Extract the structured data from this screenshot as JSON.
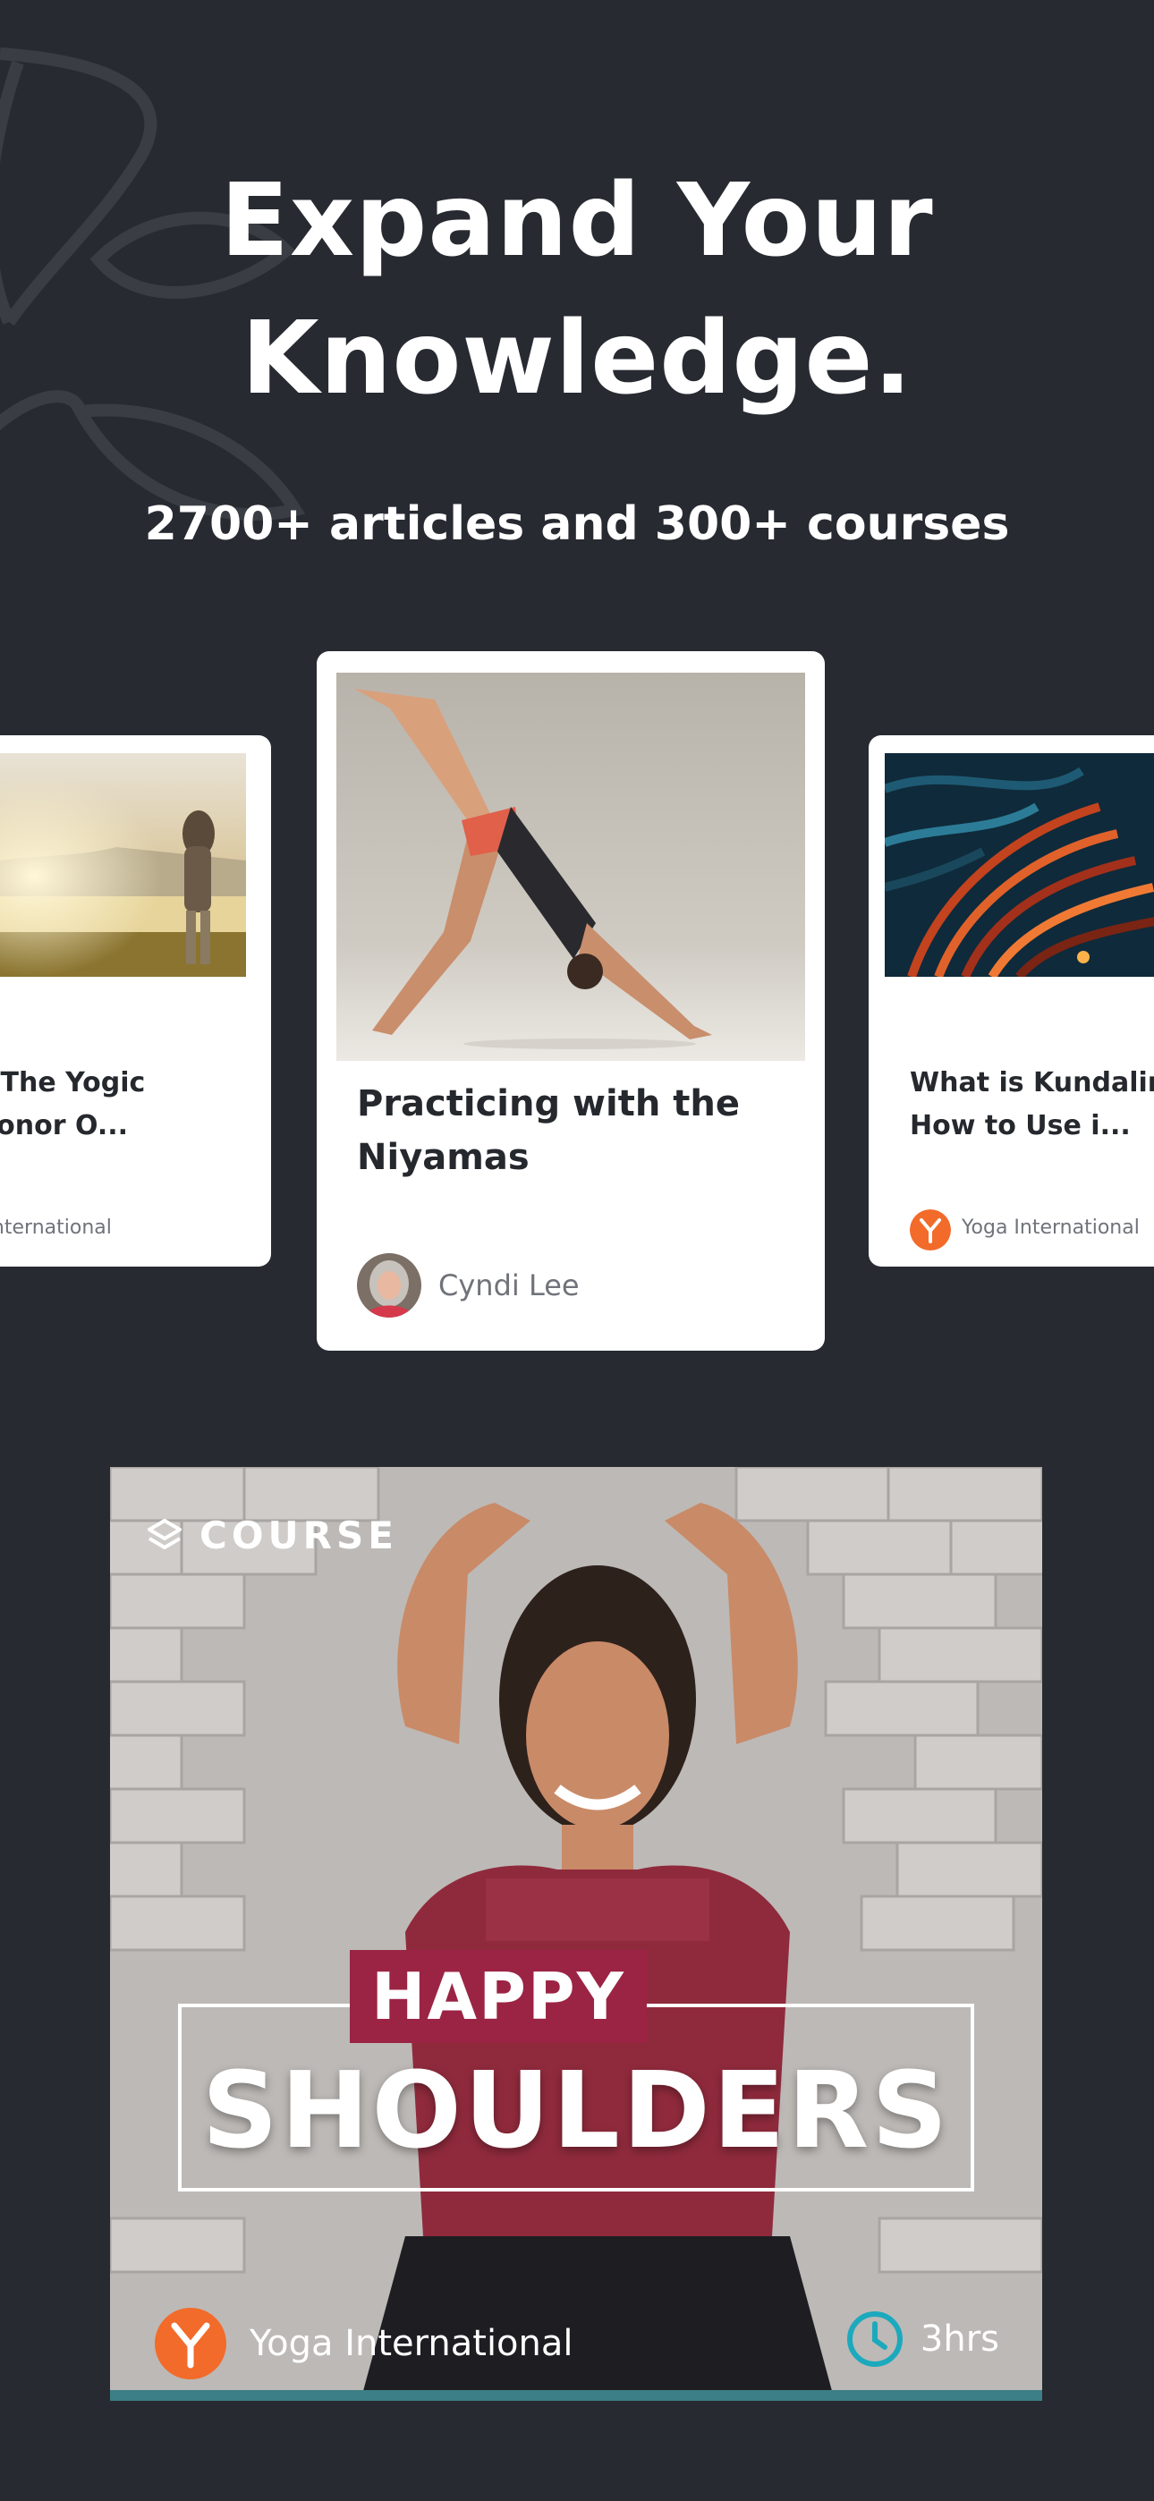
{
  "hero": {
    "title_line1": "Expand Your",
    "title_line2": "Knowledge.",
    "subtitle": "2700+ articles and 300+ courses"
  },
  "cards": [
    {
      "title_line1": "sa: The Yogic",
      "title_line2": "o Honor O...",
      "author": "ga International"
    },
    {
      "title": "Practicing with the Niyamas",
      "author": "Cyndi Lee"
    },
    {
      "title_line1": "What is Kundalini &",
      "title_line2": "How to Use i...",
      "author": "Yoga International"
    }
  ],
  "course": {
    "tag": "COURSE",
    "title_top": "HAPPY",
    "title_main": "SHOULDERS",
    "brand": "Yoga International",
    "duration": "3hrs"
  },
  "colors": {
    "background": "#272a31",
    "accent_orange": "#f26b2a",
    "course_tag_red": "#9b2444",
    "clock_teal": "#1ca9bd"
  },
  "icons": {
    "course": "layers-icon",
    "clock": "clock-icon",
    "brand": "yoga-international-logo"
  }
}
